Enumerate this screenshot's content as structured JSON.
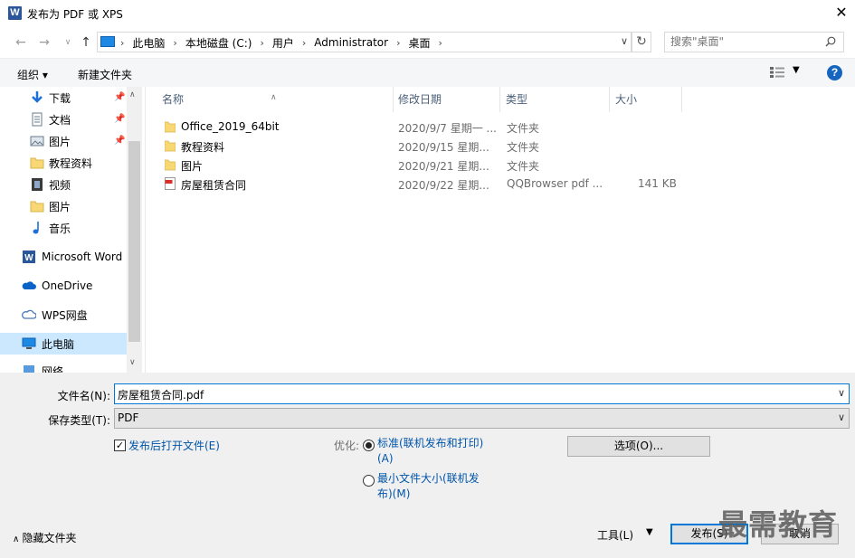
{
  "window": {
    "title": "发布为 PDF 或 XPS",
    "app_icon_letter": "W",
    "close_glyph": "✕"
  },
  "address": {
    "crumbs": [
      "此电脑",
      "本地磁盘 (C:)",
      "用户",
      "Administrator",
      "桌面"
    ],
    "search_placeholder": "搜索\"桌面\""
  },
  "toolbar": {
    "organize": "组织 ▾",
    "new_folder": "新建文件夹",
    "help": "?"
  },
  "nav": {
    "items": [
      {
        "label": "下载",
        "icon": "download-icon",
        "pinned": true
      },
      {
        "label": "文档",
        "icon": "document-icon",
        "pinned": true
      },
      {
        "label": "图片",
        "icon": "picture-icon",
        "pinned": true
      },
      {
        "label": "教程资料",
        "icon": "folder-icon",
        "pinned": false
      },
      {
        "label": "视频",
        "icon": "video-icon",
        "pinned": false
      },
      {
        "label": "图片",
        "icon": "folder-icon",
        "pinned": false
      },
      {
        "label": "音乐",
        "icon": "music-icon",
        "pinned": false
      },
      {
        "label": "Microsoft Word",
        "icon": "word-icon",
        "pinned": false
      },
      {
        "label": "OneDrive",
        "icon": "cloud-icon",
        "pinned": false
      },
      {
        "label": "WPS网盘",
        "icon": "cloud-outline-icon",
        "pinned": false
      },
      {
        "label": "此电脑",
        "icon": "computer-icon",
        "pinned": false
      },
      {
        "label": "网络",
        "icon": "network-icon",
        "pinned": false
      }
    ]
  },
  "columns": [
    "名称",
    "修改日期",
    "类型",
    "大小"
  ],
  "files": [
    {
      "name": "Office_2019_64bit",
      "date": "2020/9/7 星期一 ...",
      "type": "文件夹",
      "size": "",
      "icon": "folder-icon"
    },
    {
      "name": "教程资料",
      "date": "2020/9/15 星期...",
      "type": "文件夹",
      "size": "",
      "icon": "folder-icon"
    },
    {
      "name": "图片",
      "date": "2020/9/21 星期...",
      "type": "文件夹",
      "size": "",
      "icon": "folder-icon"
    },
    {
      "name": "房屋租赁合同",
      "date": "2020/9/22 星期...",
      "type": "QQBrowser pdf ...",
      "size": "141 KB",
      "icon": "pdf-icon"
    }
  ],
  "form": {
    "filename_label": "文件名(N):",
    "filename_value": "房屋租赁合同.pdf",
    "savetype_label": "保存类型(T):",
    "savetype_value": "PDF",
    "open_after_label": "发布后打开文件(E)",
    "open_after_checked": true,
    "optimize_label": "优化:",
    "opt_standard": "标准(联机发布和打印)(A)",
    "opt_minimum": "最小文件大小(联机发布)(M)",
    "options_button": "选项(O)...",
    "hide_folders": "隐藏文件夹",
    "tools": "工具(L)",
    "publish": "发布(S)",
    "cancel": "取消"
  },
  "watermark": "最需教育",
  "colors": {
    "selection": "#cce8ff",
    "accent": "#0078d7",
    "link_text": "#0055aa",
    "folder": "#f8d775"
  }
}
